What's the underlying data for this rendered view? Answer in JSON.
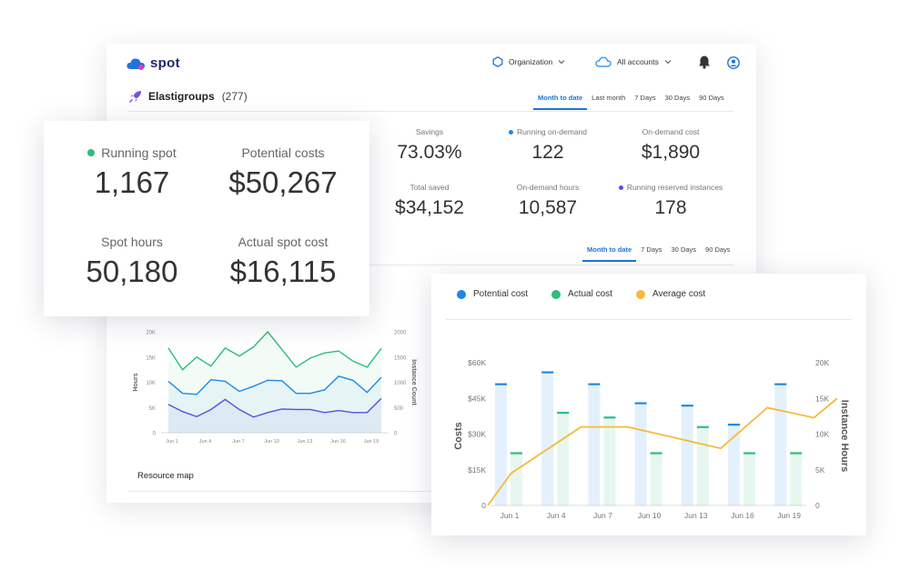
{
  "app": {
    "logo_text": "spot"
  },
  "header": {
    "org_label": "Organization",
    "accounts_label": "All accounts"
  },
  "section": {
    "title": "Elastigroups",
    "count": "(277)"
  },
  "tabs_top": [
    "Month to date",
    "Last month",
    "7 Days",
    "30 Days",
    "90 Days"
  ],
  "tabs_mid": [
    "Month to date",
    "7 Days",
    "30 Days",
    "90 Days"
  ],
  "stats_main": [
    {
      "label": "Savings",
      "value": "73.03%",
      "dot": ""
    },
    {
      "label": "Running on-demand",
      "value": "122",
      "dot": "#1e88e5"
    },
    {
      "label": "On-demand cost",
      "value": "$1,890",
      "dot": ""
    },
    {
      "label": "Total saved",
      "value": "$34,152",
      "dot": ""
    },
    {
      "label": "On-demand hours",
      "value": "10,587",
      "dot": ""
    },
    {
      "label": "Running reserved instances",
      "value": "178",
      "dot": "#5b4ee0"
    }
  ],
  "stats_card": [
    {
      "label": "Running spot",
      "value": "1,167",
      "dot": "#2ebd7f"
    },
    {
      "label": "Potential costs",
      "value": "$50,267",
      "dot": ""
    },
    {
      "label": "Spot hours",
      "value": "50,180",
      "dot": ""
    },
    {
      "label": "Actual spot cost",
      "value": "$16,115",
      "dot": ""
    }
  ],
  "resource_map_label": "Resource map",
  "colors": {
    "accent": "#1e74d9",
    "blue": "#1e88e5",
    "green": "#2ebd7f",
    "orange": "#f6b93b",
    "purple": "#5b4ee0"
  },
  "chart_data": [
    {
      "type": "line",
      "categories": [
        "Jun 1",
        "Jun 4",
        "Jun 7",
        "Jun 10",
        "Jun 13",
        "Jun 16",
        "Jun 19"
      ],
      "ylabel": "Hours",
      "y2label": "Instance Count",
      "ylim": [
        0,
        20000
      ],
      "y2lim": [
        0,
        2000
      ],
      "yticks": [
        "0",
        "5K",
        "10K",
        "15K",
        "20K"
      ],
      "y2ticks": [
        "0",
        "500",
        "1000",
        "1500",
        "2000"
      ],
      "grid": false,
      "series": [
        {
          "color": "#2ebd7f",
          "values": [
            16800,
            12500,
            15000,
            13200,
            16800,
            15200,
            17000,
            20000,
            16500,
            13000,
            14800,
            15800,
            16200,
            14200,
            13000,
            16700
          ]
        },
        {
          "color": "#1e88e5",
          "values": [
            10200,
            7800,
            7600,
            10500,
            10200,
            8200,
            9200,
            10400,
            10300,
            7800,
            7800,
            8500,
            11200,
            10400,
            8000,
            11000
          ]
        },
        {
          "color": "#5b4ee0",
          "values": [
            5600,
            4200,
            3200,
            4600,
            6600,
            4600,
            3100,
            4000,
            4700,
            4600,
            4600,
            4000,
            4400,
            4000,
            4000,
            6800
          ]
        }
      ]
    },
    {
      "type": "bar",
      "categories": [
        "Jun 1",
        "Jun 4",
        "Jun 7",
        "Jun 10",
        "Jun 13",
        "Jun 16",
        "Jun 19"
      ],
      "ylabel": "Costs",
      "y2label": "Instance Hours",
      "ylim": [
        0,
        60000
      ],
      "y2lim": [
        0,
        20000
      ],
      "yticks": [
        "0",
        "$15K",
        "$30K",
        "$45K",
        "$60K"
      ],
      "y2ticks": [
        "0",
        "5K",
        "10K",
        "15K",
        "20K"
      ],
      "legend": "top-left",
      "series": [
        {
          "name": "Potential cost",
          "color": "#1e88e5",
          "values": [
            51000,
            56000,
            51000,
            43000,
            42000,
            34000,
            51000
          ]
        },
        {
          "name": "Actual cost",
          "color": "#2ebd7f",
          "values": [
            22000,
            39000,
            37000,
            22000,
            33000,
            22000,
            22000
          ]
        },
        {
          "name": "Average cost",
          "color": "#f6b93b",
          "type": "line",
          "x": [
            0,
            0.5,
            2,
            3,
            4,
            5,
            6,
            7,
            7.5
          ],
          "values": [
            0,
            4500,
            11000,
            11000,
            9500,
            8000,
            13700,
            12300,
            15000
          ]
        }
      ]
    }
  ]
}
